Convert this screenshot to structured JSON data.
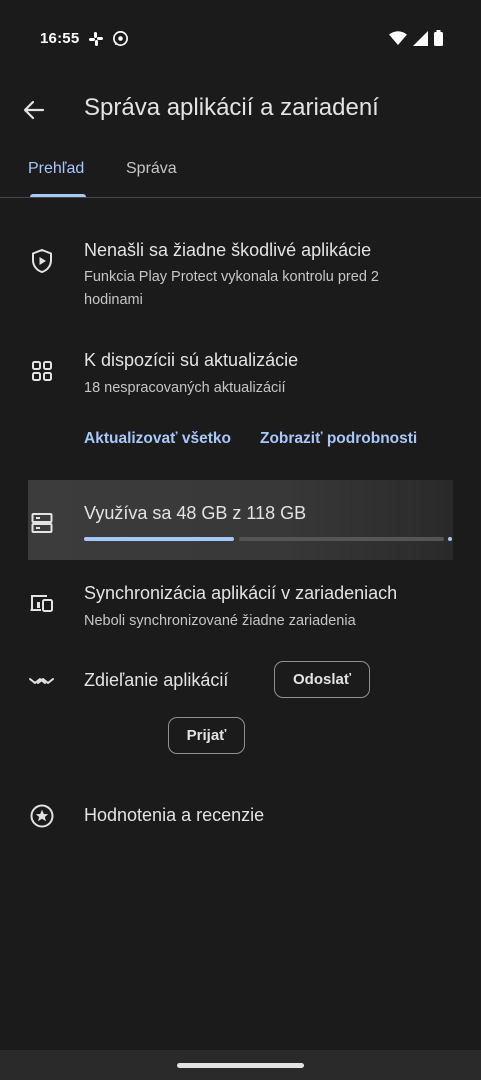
{
  "status": {
    "time": "16:55",
    "left_icons": [
      "slack-icon",
      "whatsapp-icon"
    ],
    "right_icons": [
      "wifi-icon",
      "signal-icon",
      "battery-icon"
    ]
  },
  "header": {
    "title": "Správa aplikácií a zariadení",
    "back_icon": "arrow-back-icon"
  },
  "tabs": [
    {
      "label": "Prehľad",
      "active": true
    },
    {
      "label": "Správa",
      "active": false
    }
  ],
  "protect": {
    "icon": "shield-play-icon",
    "title": "Nenašli sa žiadne škodlivé aplikácie",
    "subtitle": "Funkcia Play Protect vykonala kontrolu pred 2 hodinami"
  },
  "updates": {
    "icon": "apps-grid-icon",
    "title": "K dispozícii sú aktualizácie",
    "subtitle": "18 nespracovaných aktualizácií",
    "update_all": "Aktualizovať všetko",
    "details": "Zobraziť podrobnosti"
  },
  "storage": {
    "icon": "storage-icon",
    "title": "Využíva sa 48 GB z 118 GB",
    "used_gb": 48,
    "total_gb": 118
  },
  "sync": {
    "icon": "devices-icon",
    "title": "Synchronizácia aplikácií v zariadeniach",
    "subtitle": "Neboli synchronizované žiadne zariadenia"
  },
  "sharing": {
    "icon": "nearby-share-icon",
    "title": "Zdieľanie aplikácií",
    "send": "Odoslať",
    "receive": "Prijať"
  },
  "ratings": {
    "icon": "star-circle-icon",
    "title": "Hodnotenia a recenzie"
  },
  "colors": {
    "background": "#1b1b1c",
    "accent": "#a8c7fa",
    "text": "#e3e3e3"
  }
}
